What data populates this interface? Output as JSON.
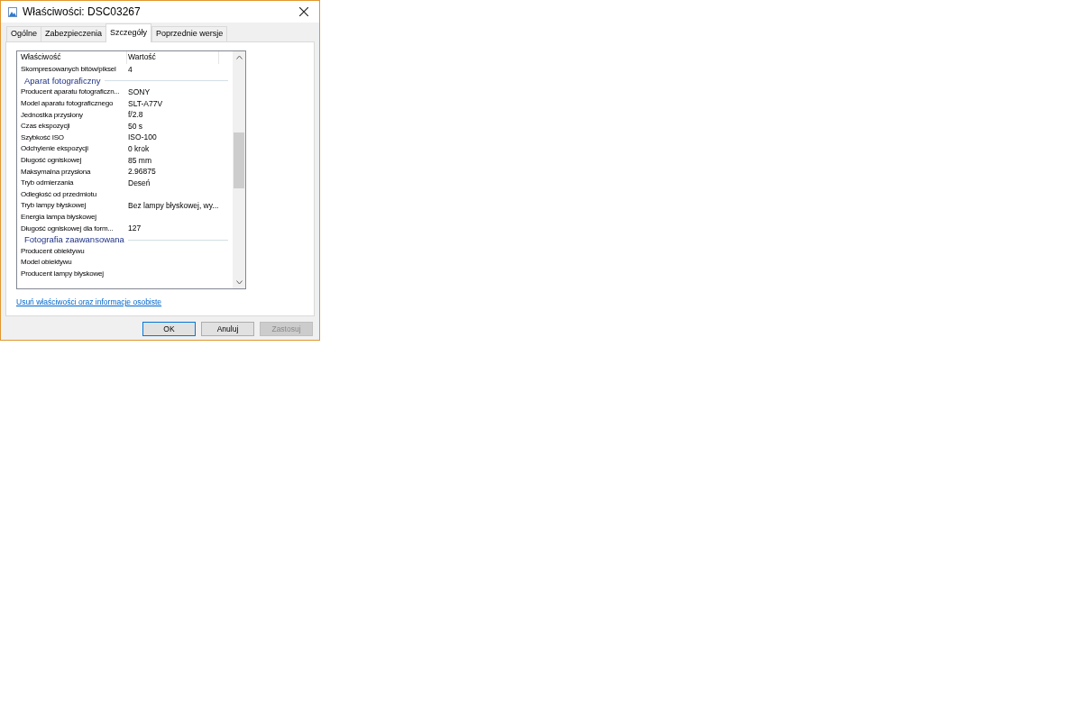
{
  "window": {
    "title": "Właściwości: DSC03267"
  },
  "tabs": [
    {
      "label": "Ogólne",
      "selected": false
    },
    {
      "label": "Zabezpieczenia",
      "selected": false
    },
    {
      "label": "Szczegóły",
      "selected": true
    },
    {
      "label": "Poprzednie wersje",
      "selected": false
    }
  ],
  "table": {
    "columns": [
      "Właściwość",
      "Wartość"
    ],
    "rows": [
      {
        "kind": "row",
        "name": "Skompresowanych bitów/piksel",
        "value": "4"
      },
      {
        "kind": "group",
        "name": "Aparat fotograficzny"
      },
      {
        "kind": "row",
        "name": "Producent aparatu fotograficzn...",
        "value": "SONY"
      },
      {
        "kind": "row",
        "name": "Model aparatu fotograficznego",
        "value": "SLT-A77V"
      },
      {
        "kind": "row",
        "name": "Jednostka przysłony",
        "value": "f/2.8"
      },
      {
        "kind": "row",
        "name": "Czas ekspozycji",
        "value": "50 s"
      },
      {
        "kind": "row",
        "name": "Szybkość ISO",
        "value": "ISO-100"
      },
      {
        "kind": "row",
        "name": "Odchylenie ekspozycji",
        "value": "0 krok"
      },
      {
        "kind": "row",
        "name": "Długość ogniskowej",
        "value": "85 mm"
      },
      {
        "kind": "row",
        "name": "Maksymalna przysłona",
        "value": "2.96875"
      },
      {
        "kind": "row",
        "name": "Tryb odmierzania",
        "value": "Deseń"
      },
      {
        "kind": "row",
        "name": "Odległość od przedmiotu"
      },
      {
        "kind": "row",
        "name": "Tryb lampy błyskowej",
        "value": "Bez lampy błyskowej, wy..."
      },
      {
        "kind": "row",
        "name": "Energia lampa błyskowej"
      },
      {
        "kind": "row",
        "name": "Długość ogniskowej dla form...",
        "value": "127"
      },
      {
        "kind": "group",
        "name": "Fotografia zaawansowana"
      },
      {
        "kind": "row",
        "name": "Producent obiektywu"
      },
      {
        "kind": "row",
        "name": "Model obiektywu"
      },
      {
        "kind": "row",
        "name": "Producent lampy błyskowej"
      }
    ]
  },
  "link": "Usuń właściwości oraz informacje osobiste",
  "buttons": [
    {
      "label": "OK",
      "default": true,
      "disabled": false
    },
    {
      "label": "Anuluj",
      "default": false,
      "disabled": false
    },
    {
      "label": "Zastosuj",
      "default": false,
      "disabled": true
    }
  ]
}
